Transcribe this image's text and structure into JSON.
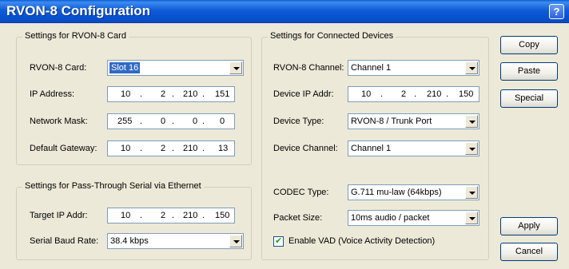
{
  "window": {
    "title": "RVON-8 Configuration",
    "help_label": "?"
  },
  "card_group": {
    "title": "Settings for RVON-8 Card",
    "rvon_card_label": "RVON-8 Card:",
    "rvon_card_value": "Slot 16",
    "ip_label": "IP Address:",
    "ip": [
      "10",
      "2",
      "210",
      "151"
    ],
    "mask_label": "Network Mask:",
    "mask": [
      "255",
      "0",
      "0",
      "0"
    ],
    "gateway_label": "Default Gateway:",
    "gateway": [
      "10",
      "2",
      "210",
      "13"
    ]
  },
  "serial_group": {
    "title": "Settings for Pass-Through Serial via Ethernet",
    "target_ip_label": "Target IP Addr:",
    "target_ip": [
      "10",
      "2",
      "210",
      "150"
    ],
    "baud_label": "Serial Baud Rate:",
    "baud_value": "38.4 kbps"
  },
  "devices_group": {
    "title": "Settings for Connected Devices",
    "channel_label": "RVON-8 Channel:",
    "channel_value": "Channel 1",
    "device_ip_label": "Device IP Addr:",
    "device_ip": [
      "10",
      "2",
      "210",
      "150"
    ],
    "device_type_label": "Device Type:",
    "device_type_value": "RVON-8 / Trunk Port",
    "device_channel_label": "Device Channel:",
    "device_channel_value": "Channel 1",
    "codec_label": "CODEC Type:",
    "codec_value": "G.711 mu-law (64kbps)",
    "packet_label": "Packet Size:",
    "packet_value": "10ms audio / packet",
    "vad_label": "Enable VAD (Voice Activity Detection)",
    "vad_checked": true
  },
  "buttons": {
    "copy": "Copy",
    "paste": "Paste",
    "special": "Special",
    "apply": "Apply",
    "cancel": "Cancel"
  },
  "ip_separator": "."
}
